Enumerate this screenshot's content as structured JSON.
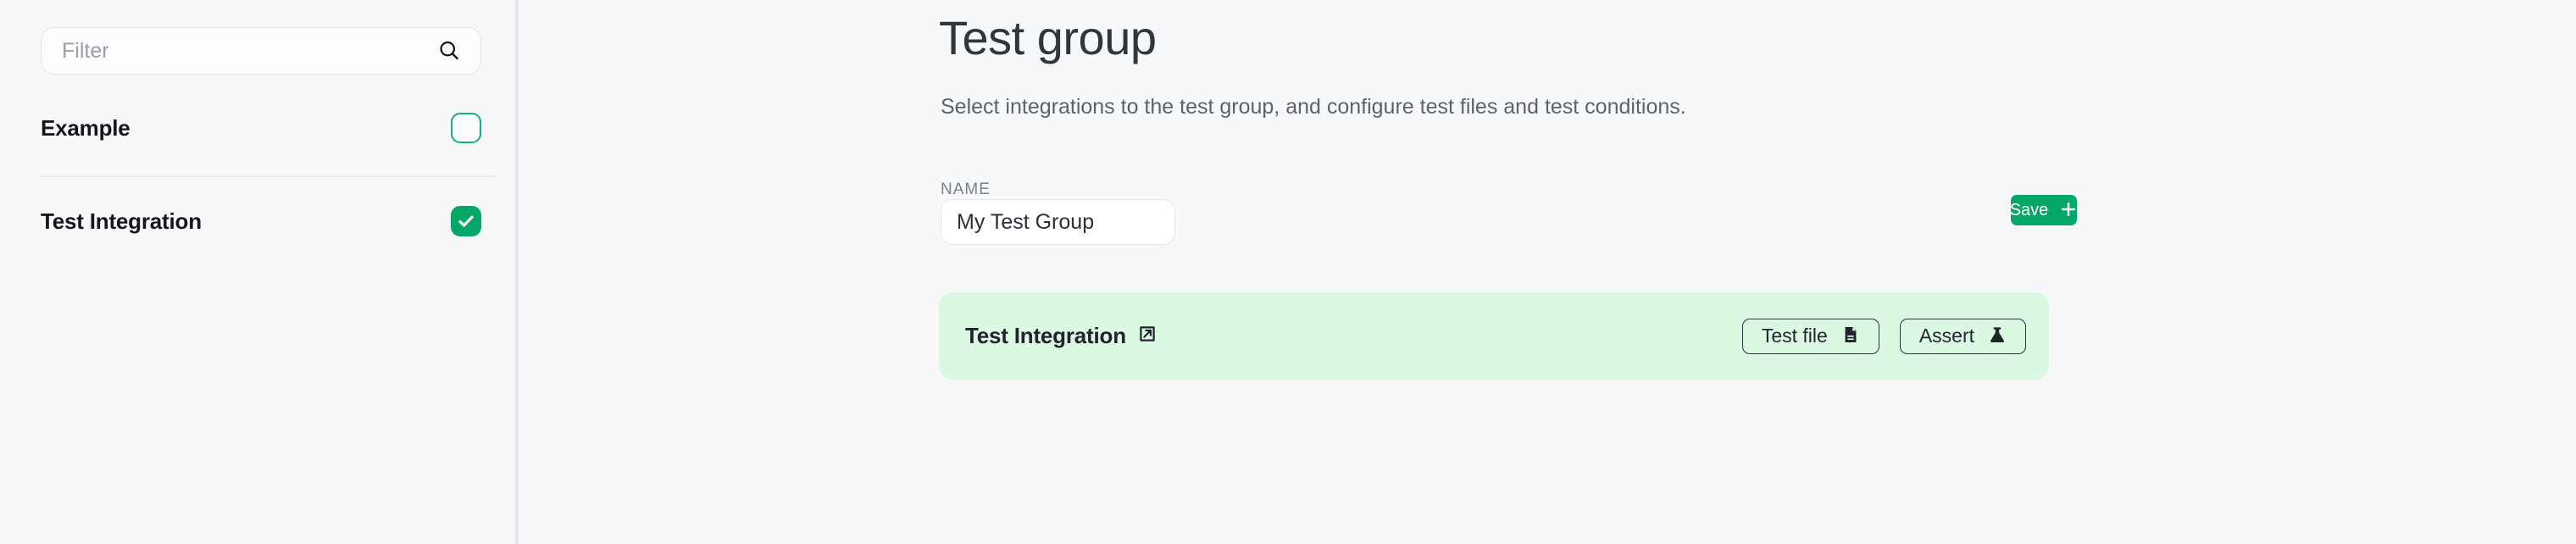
{
  "sidebar": {
    "search": {
      "placeholder": "Filter",
      "value": "",
      "icon": "search-icon"
    },
    "items": [
      {
        "label": "Example",
        "checked": false,
        "checkbox_icon": "checkbox-unchecked-icon"
      },
      {
        "label": "Test Integration",
        "checked": true,
        "checkbox_icon": "checkbox-checked-icon"
      }
    ]
  },
  "main": {
    "title": "Test group",
    "subtitle": "Select integrations to the test group, and configure test files and test conditions.",
    "name_field": {
      "label": "NAME",
      "value": "My Test Group",
      "placeholder": ""
    },
    "save": {
      "label": "Save",
      "icon": "plus-icon"
    },
    "integration_card": {
      "title": "Test Integration",
      "link_icon": "external-link-icon",
      "actions": [
        {
          "label": "Test file",
          "icon": "document-icon"
        },
        {
          "label": "Assert",
          "icon": "flask-icon"
        }
      ]
    }
  },
  "colors": {
    "accent_green": "#04a768",
    "checkbox_outline_green": "#16b07a",
    "card_background": "#dbf8e3",
    "page_background": "#f7f8fa",
    "text_primary": "#20242b",
    "text_muted": "#5d636b"
  }
}
